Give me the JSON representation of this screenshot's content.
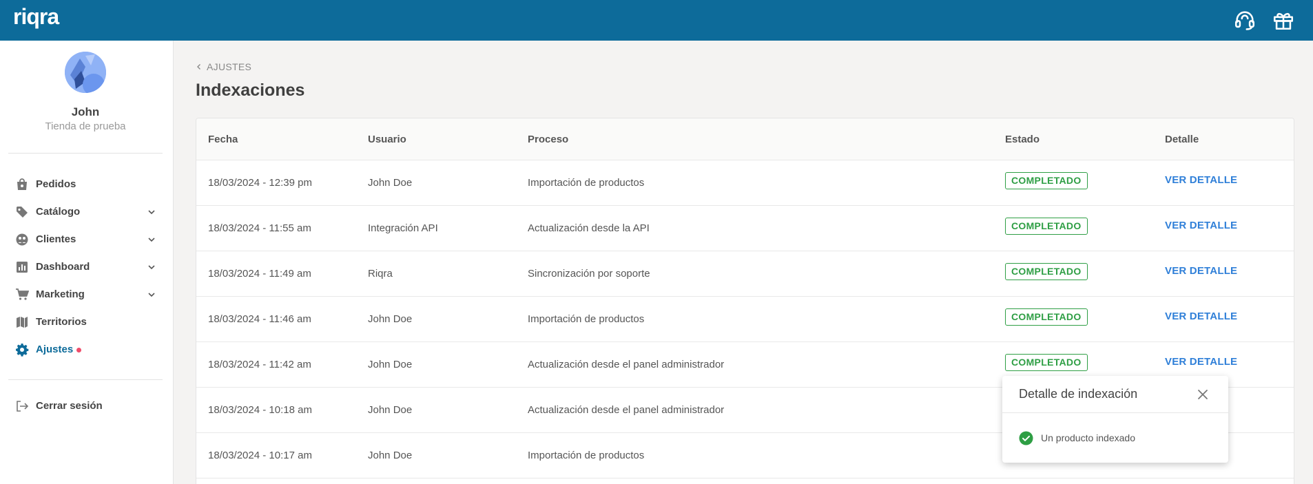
{
  "app": {
    "logo": "riqra"
  },
  "topbar": {
    "support_icon": "headset-icon",
    "gift_icon": "gift-icon"
  },
  "user": {
    "name": "John",
    "store": "Tienda de prueba"
  },
  "sidebar": {
    "items": [
      {
        "label": "Pedidos",
        "icon": "shopping-bag-icon"
      },
      {
        "label": "Catálogo",
        "icon": "tag-icon"
      },
      {
        "label": "Clientes",
        "icon": "users-icon"
      },
      {
        "label": "Dashboard",
        "icon": "bar-chart-icon"
      },
      {
        "label": "Marketing",
        "icon": "cart-icon"
      },
      {
        "label": "Territorios",
        "icon": "map-icon"
      },
      {
        "label": "Ajustes",
        "icon": "gear-icon"
      }
    ],
    "logout": "Cerrar sesión",
    "accent_color": "#0d6b9a",
    "notification_dot_color": "#ef4d6b"
  },
  "main": {
    "breadcrumb": "AJUSTES",
    "title": "Indexaciones",
    "table": {
      "headers": [
        "Fecha",
        "Usuario",
        "Proceso",
        "Estado",
        "Detalle"
      ],
      "rows": [
        {
          "fecha": "18/03/2024 - 12:39 pm",
          "usuario": "John Doe",
          "proceso": "Importación de productos",
          "estado": "COMPLETADO",
          "detalle": "VER DETALLE"
        },
        {
          "fecha": "18/03/2024 - 11:55 am",
          "usuario": "Integración API",
          "proceso": "Actualización desde la API",
          "estado": "COMPLETADO",
          "detalle": "VER DETALLE"
        },
        {
          "fecha": "18/03/2024 - 11:49 am",
          "usuario": "Riqra",
          "proceso": "Sincronización por soporte",
          "estado": "COMPLETADO",
          "detalle": "VER DETALLE"
        },
        {
          "fecha": "18/03/2024 - 11:46 am",
          "usuario": "John Doe",
          "proceso": "Importación de productos",
          "estado": "COMPLETADO",
          "detalle": "VER DETALLE"
        },
        {
          "fecha": "18/03/2024 - 11:42 am",
          "usuario": "John Doe",
          "proceso": "Actualización desde el panel administrador",
          "estado": "COMPLETADO",
          "detalle": "VER DETALLE"
        },
        {
          "fecha": "18/03/2024 - 10:18 am",
          "usuario": "John Doe",
          "proceso": "Actualización desde el panel administrador",
          "estado": "",
          "detalle": ""
        },
        {
          "fecha": "18/03/2024 - 10:17 am",
          "usuario": "John Doe",
          "proceso": "Importación de productos",
          "estado": "",
          "detalle": ""
        }
      ]
    },
    "status_color": "#2e9e44",
    "link_color": "#2f7fd8"
  },
  "popover": {
    "title": "Detalle de indexación",
    "message": "Un producto indexado",
    "close_icon": "close-icon",
    "check_icon": "check-circle-icon"
  }
}
